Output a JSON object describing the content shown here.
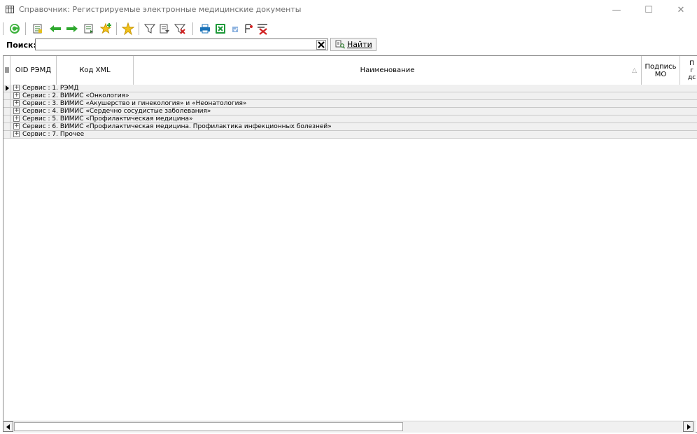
{
  "window": {
    "title": "Справочник: Регистрируемые электронные медицинские документы",
    "minimize": "—",
    "maximize": "☐",
    "close": "✕"
  },
  "search": {
    "label": "Поиск:",
    "value": "",
    "find_label": "Найти"
  },
  "grid": {
    "columns": {
      "oid": "OID РЭМД",
      "code": "Код XML",
      "name": "Наименование",
      "sign": "Подпись МО",
      "partial": "П\nг\nдс"
    },
    "sort_indicator": "△",
    "rows": [
      "Сервис : 1. РЭМД",
      "Сервис : 2. ВИМИС «Онкология»",
      "Сервис : 3. ВИМИС «Акушерство и гинекология» и «Неонатология»",
      "Сервис : 4. ВИМИС «Сердечно сосудистые заболевания»",
      "Сервис : 5. ВИМИС «Профилактическая медицина»",
      "Сервис : 6. ВИМИС «Профилактическая медицина. Профилактика инфекционных болезней»",
      "Сервис : 7. Прочее"
    ],
    "expand_glyph": "+"
  },
  "icons": {
    "toolbar": [
      "refresh-icon",
      "edit-record-icon",
      "arrow-left-icon",
      "arrow-right-icon",
      "copy-record-icon",
      "star-add-icon",
      "star-icon",
      "filter-icon",
      "filter-edit-icon",
      "filter-clear-icon",
      "print-icon",
      "export-excel-icon",
      "mark-icon",
      "sort-filter-icon",
      "delete-marks-icon"
    ]
  }
}
